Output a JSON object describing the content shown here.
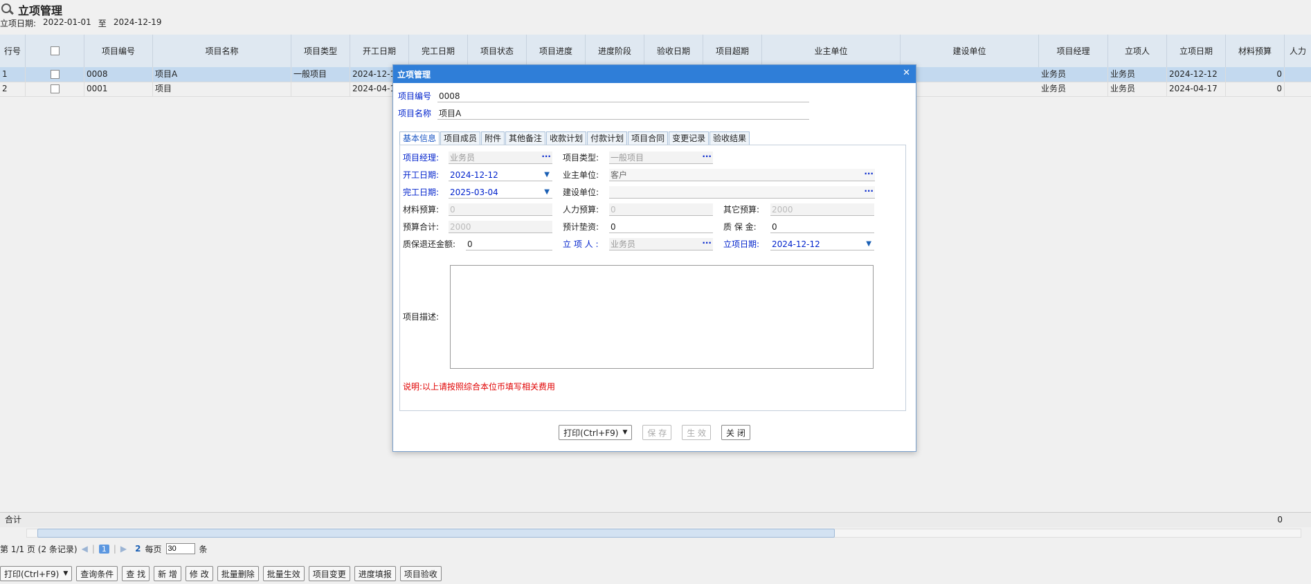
{
  "page": {
    "title": "立项管理",
    "date_label": "立项日期:",
    "date_from": "2022-01-01",
    "date_sep": "至",
    "date_to": "2024-12-19"
  },
  "grid": {
    "columns": [
      "行号",
      "",
      "项目编号",
      "项目名称",
      "项目类型",
      "开工日期",
      "完工日期",
      "项目状态",
      "项目进度",
      "进度阶段",
      "验收日期",
      "项目超期",
      "业主单位",
      "建设单位",
      "项目经理",
      "立项人",
      "立项日期",
      "材料预算",
      "人力"
    ],
    "rows": [
      {
        "no": "1",
        "code": "0008",
        "name": "项目A",
        "type": "一般项目",
        "start": "2024-12-12",
        "manager": "业务员",
        "creator": "业务员",
        "date": "2024-12-12",
        "material": "0",
        "selected": true
      },
      {
        "no": "2",
        "code": "0001",
        "name": "项目",
        "type": "",
        "start": "2024-04-17",
        "manager": "业务员",
        "creator": "业务员",
        "date": "2024-04-17",
        "material": "0",
        "selected": false
      }
    ],
    "sum_label": "合计",
    "sum_material": "0"
  },
  "pager": {
    "page_text": "第 1/1 页 (2 条记录)",
    "current": "1",
    "next": "2",
    "per_page_label": "每页",
    "per_page": "30",
    "unit": "条"
  },
  "toolbar": [
    "打印(Ctrl+F9)",
    "查询条件",
    "查 找",
    "新 增",
    "修 改",
    "批量删除",
    "批量生效",
    "项目变更",
    "进度填报",
    "项目验收"
  ],
  "dialog": {
    "title": "立项管理",
    "code_label": "项目编号",
    "code": "0008",
    "name_label": "项目名称",
    "name": "项目A",
    "tabs": [
      "基本信息",
      "项目成员",
      "附件",
      "其他备注",
      "收款计划",
      "付款计划",
      "项目合同",
      "变更记录",
      "验收结果"
    ],
    "fields": {
      "manager_label": "项目经理:",
      "manager": "业务员",
      "type_label": "项目类型:",
      "type": "一般项目",
      "start_label": "开工日期:",
      "start": "2024-12-12",
      "owner_label": "业主单位:",
      "owner": "客户",
      "end_label": "完工日期:",
      "end": "2025-03-04",
      "builder_label": "建设单位:",
      "builder": "",
      "material_label": "材料预算:",
      "material": "0",
      "labor_label": "人力预算:",
      "labor": "0",
      "other_label": "其它预算:",
      "other": "2000",
      "total_label": "预算合计:",
      "total": "2000",
      "advance_label": "预计垫资:",
      "advance": "0",
      "warranty_label": "质 保 金:",
      "warranty": "0",
      "refund_label": "质保退还金额:",
      "refund": "0",
      "creator_label": "立 项 人 :",
      "creator": "业务员",
      "date_label": "立项日期:",
      "date": "2024-12-12",
      "desc_label": "项目描述:"
    },
    "note": "说明:以上请按照综合本位币填写相关费用",
    "buttons": {
      "print": "打印(Ctrl+F9)",
      "save": "保 存",
      "effect": "生 效",
      "close": "关 闭"
    }
  }
}
